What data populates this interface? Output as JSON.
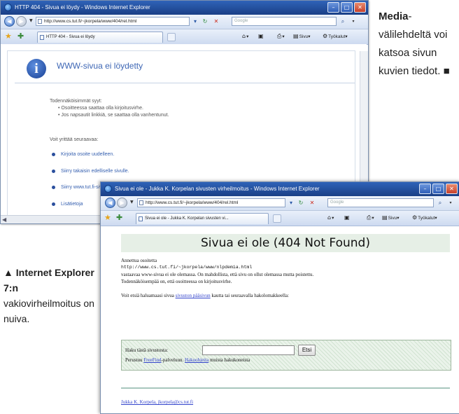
{
  "window1": {
    "title": "HTTP 404 - Sivua ei löydy - Windows Internet Explorer",
    "address": "http://www.cs.tut.fi/~jkorpela/www/404/rel.html",
    "search_placeholder": "Google",
    "tab_label": "HTTP 404 - Sivua ei löydy",
    "toolbar_page": "Sivu",
    "toolbar_tools": "Työkalut",
    "page": {
      "heading": "WWW-sivua ei löydetty",
      "causes_title": "Todennäköisimmät syyt:",
      "causes": [
        "Osoitteessa saattaa olla kirjoitusvirhe.",
        "Jos napsautit linkkiä, se saattaa olla vanhentunut."
      ],
      "try_title": "Voit yrittää seuraavaa:",
      "actions": [
        "Kirjoita osoite uudelleen.",
        "Siirry takaisin edelliselle sivulle.",
        "Siirry www.tut.fi-sivustoon ja etsi haluamasi tiedot.",
        "Lisätietoja"
      ]
    }
  },
  "window2": {
    "title": "Sivua ei ole - Jukka K. Korpelan sivusten virheilmoitus - Windows Internet Explorer",
    "address": "http://www.cs.tut.fi/~jkorpela/www/404/rel.html",
    "search_placeholder": "Google",
    "tab_label": "Sivua ei ole - Jukka K. Korpelan sivusten vi...",
    "toolbar_page": "Sivu",
    "toolbar_tools": "Työkalut",
    "page": {
      "heading": "Sivua ei ole (404 Not Found)",
      "line1": "Annettua osoitetta",
      "url_line": "http://www.cs.tut.fi/~jkorpela/www/nlpdemia.html",
      "line3": "vastaavaa www-sivua ei ole olemassa. On mahdollista, että sivu on ollut olemassa mutta poistettu.",
      "line4": "Todennäköisempää on, että osoitteessa on kirjoitusvirhe.",
      "find_prefix": "Voit etsiä haluamaasi sivua",
      "find_link": "sivuston pääsivun",
      "find_suffix": "kautta tai seuraavalla hakolomakkeella:",
      "search_label": "Haku tästä sivustosta:",
      "search_button": "Etsi",
      "engines_prefix": "Perustuu",
      "engines_link1": "FreeFind",
      "engines_mid": "-palveluun.",
      "engines_link2": "Hakuohjeita",
      "engines_suffix": "muista hakukoneista",
      "footer_link": "Jukka K. Korpela, jkorpela@cs.tut.fi"
    }
  },
  "side_caption": {
    "bold": "Media",
    "text": "-välilehdeltä voi katsoa sivun kuvien tiedot.",
    "end_mark": "■"
  },
  "caption": {
    "marker": "▲",
    "bold": "Internet Explorer 7:n",
    "text": "vakiovirheilmoitus on nuiva."
  }
}
